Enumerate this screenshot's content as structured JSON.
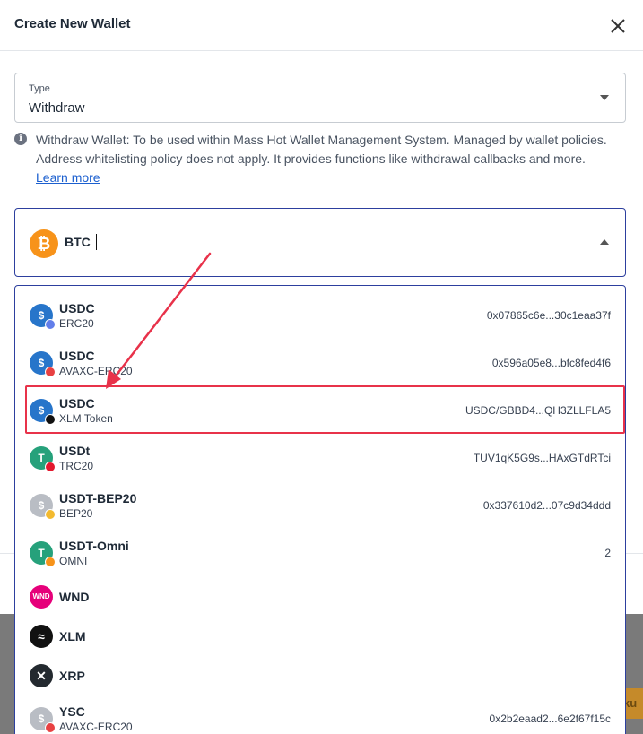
{
  "dialog": {
    "title": "Create New Wallet",
    "close_icon": "close-icon"
  },
  "type_select": {
    "label": "Type",
    "value": "Withdraw"
  },
  "info": {
    "icon": "info-icon",
    "text": "Withdraw Wallet: To be used within Mass Hot Wallet Management System. Managed by wallet policies. Address whitelisting policy does not apply. It provides functions like withdrawal callbacks and more.",
    "link": "Learn more"
  },
  "asset_select": {
    "value": "BTC",
    "icon": "bitcoin-icon"
  },
  "options": [
    {
      "name": "USDC",
      "network": "ERC20",
      "address": "0x07865c6e...30c1eaa37f",
      "icon": "usdc-icon",
      "color": "#2775ca",
      "sub_color": "#627eea"
    },
    {
      "name": "USDC",
      "network": "AVAXC-ERC20",
      "address": "0x596a05e8...bfc8fed4f6",
      "icon": "usdc-icon",
      "color": "#2775ca",
      "sub_color": "#e84142"
    },
    {
      "name": "USDC",
      "network": "XLM Token",
      "address": "USDC/GBBD4...QH3ZLLFLA5",
      "icon": "usdc-icon",
      "color": "#2775ca",
      "sub_color": "#111111"
    },
    {
      "name": "USDt",
      "network": "TRC20",
      "address": "TUV1qK5G9s...HAxGTdRTci",
      "icon": "tether-icon",
      "color": "#26a17b",
      "sub_color": "#e3182d"
    },
    {
      "name": "USDT-BEP20",
      "network": "BEP20",
      "address": "0x337610d2...07c9d34ddd",
      "icon": "tether-icon",
      "color": "#b9bdc4",
      "sub_color": "#f3ba2f"
    },
    {
      "name": "USDT-Omni",
      "network": "OMNI",
      "address": "2",
      "icon": "tether-icon",
      "color": "#26a17b",
      "sub_color": "#f7931a"
    },
    {
      "name": "WND",
      "network": "",
      "address": "",
      "icon": "wnd-icon",
      "color": "#e6007a",
      "sub_color": ""
    },
    {
      "name": "XLM",
      "network": "",
      "address": "",
      "icon": "stellar-icon",
      "color": "#111111",
      "sub_color": ""
    },
    {
      "name": "XRP",
      "network": "",
      "address": "",
      "icon": "xrp-icon",
      "color": "#23292f",
      "sub_color": ""
    },
    {
      "name": "YSC",
      "network": "AVAXC-ERC20",
      "address": "0x2b2eaad2...6e2f67f15c",
      "icon": "ysc-icon",
      "color": "#b9bdc4",
      "sub_color": "#e84142"
    }
  ],
  "backdrop_button": {
    "label": "ku"
  },
  "annotation": {
    "highlight_color": "#e8324a"
  }
}
